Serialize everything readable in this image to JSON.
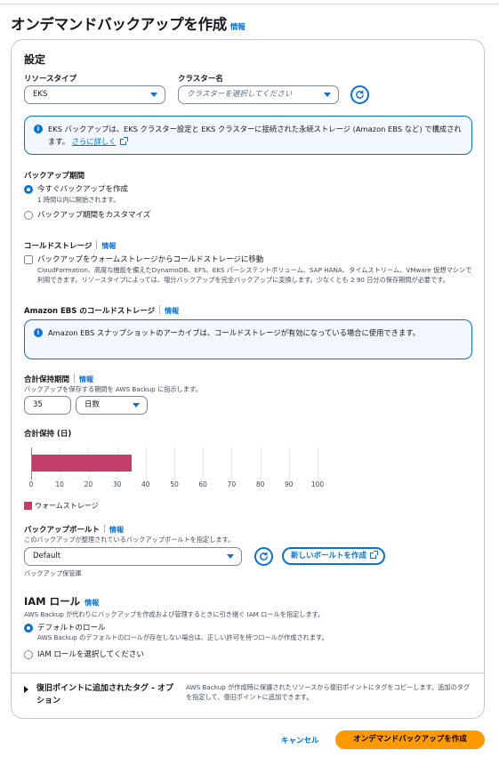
{
  "page": {
    "title": "オンデマンドバックアップを作成",
    "info": "情報"
  },
  "settings": {
    "title": "設定",
    "resource_type": {
      "label": "リソースタイプ",
      "value": "EKS"
    },
    "cluster_name": {
      "label": "クラスター名",
      "placeholder": "クラスターを選択してください"
    },
    "eks_alert": {
      "text": "EKS バックアップは、EKS クラスター設定と EKS クラスターに接続された永続ストレージ (Amazon EBS など) で構成されます。",
      "link": "さらに詳しく"
    },
    "window": {
      "label": "バックアップ期間",
      "now": "今すぐバックアップを作成",
      "now_desc": "1 時間以内に開始されます。",
      "custom": "バックアップ期間をカスタマイズ"
    },
    "cold": {
      "label": "コールドストレージ",
      "info": "情報",
      "check_label": "バックアップをウォームストレージからコールドストレージに移動",
      "desc": "CloudFormation、高度な機能を備えたDynamoDB、EFS、EKS パーシステントボリューム、SAP HANA、タイムストリーム、VMware 仮想マシンで利用できます。リソースタイプによっては、増分バックアップを完全バックアップに変換します。少なくとも 2 90 日分の保存期間が必要です。"
    },
    "ebs_cold": {
      "label": "Amazon EBS のコールドストレージ",
      "info": "情報",
      "alert": "Amazon EBS スナップショットのアーカイブは、コールドストレージが有効になっている場合に使用できます。"
    },
    "retention": {
      "label": "合計保持期間",
      "info": "情報",
      "desc": "バックアップを保存する期間を AWS Backup に指示します。",
      "value": "35",
      "unit": "日数"
    },
    "chart_title": "合計保持 (日)",
    "chart_data": {
      "type": "bar",
      "categories": [
        "ウォームストレージ"
      ],
      "values": [
        35
      ],
      "xlim": [
        0,
        100
      ],
      "xticks": [
        "0",
        "10",
        "20",
        "30",
        "40",
        "50",
        "60",
        "70",
        "80",
        "90",
        "100"
      ],
      "color": "#c33d69",
      "legend": "ウォームストレージ"
    },
    "vault": {
      "label": "バックアップボールト",
      "info": "情報",
      "desc": "このバックアップが整理されているバックアップボールトを指定します。",
      "value": "Default",
      "create_button": "新しいボールトを作成",
      "hint": "バックアップ保管庫"
    },
    "iam": {
      "label": "IAM ロール",
      "info": "情報",
      "desc": "AWS Backup が代わりにバックアップを作成および管理するときに引き継ぐ IAM ロールを指定します。",
      "default": "デフォルトのロール",
      "default_desc": "AWS Backup のデフォルトのロールが存在しない場合は、正しい許可を持つロールが作成されます。",
      "choose": "IAM ロールを選択してください"
    },
    "tags": {
      "label": "復旧ポイントに追加されたタグ - オプション",
      "desc": "AWS Backup が作成時に保護されたリソースから復旧ポイントにタグをコピーします。追加のタグを指定して、復旧ポイントに追加できます。"
    }
  },
  "footer": {
    "cancel": "キャンセル",
    "create": "オンデマンドバックアップを作成"
  }
}
